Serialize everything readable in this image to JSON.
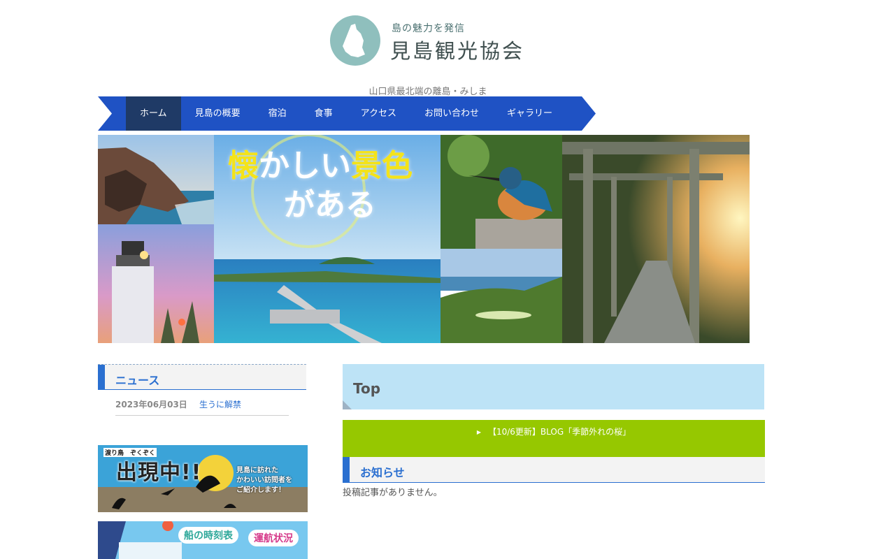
{
  "header": {
    "logo_tagline": "島の魅力を発信",
    "logo_name": "見島観光協会",
    "subtitle": "山口県最北端の離島・みしま"
  },
  "nav": {
    "items": [
      {
        "label": "ホーム",
        "active": true
      },
      {
        "label": "見島の概要",
        "active": false
      },
      {
        "label": "宿泊",
        "active": false
      },
      {
        "label": "食事",
        "active": false
      },
      {
        "label": "アクセス",
        "active": false
      },
      {
        "label": "お問い合わせ",
        "active": false
      },
      {
        "label": "ギャラリー",
        "active": false
      }
    ]
  },
  "hero": {
    "line1_a": "懐",
    "line1_b": "かしい",
    "line1_c": "景色",
    "line2": "がある"
  },
  "sidebar": {
    "news_heading": "ニュース",
    "news": [
      {
        "date": "2023年06月03日",
        "title": "生うに解禁"
      }
    ],
    "banner1": {
      "small": "渡り鳥　ぞくぞく",
      "big": "出現中!!",
      "right_line1": "見島に訪れた",
      "right_line2": "かわいい訪問者を",
      "right_line3": "ご紹介します！"
    },
    "banner2": {
      "pill1": "船の時刻表",
      "pill2": "運航状況"
    }
  },
  "main": {
    "title": "Top",
    "blog_link": "【10/6更新】BLOG「季節外れの桜」",
    "notice_heading": "お知らせ",
    "no_posts": "投稿記事がありません。"
  },
  "colors": {
    "nav_blue": "#1f52c4",
    "nav_active": "#1f3a66",
    "accent_blue": "#2a6fd0",
    "green": "#96c800",
    "title_bg": "#bde3f6"
  }
}
